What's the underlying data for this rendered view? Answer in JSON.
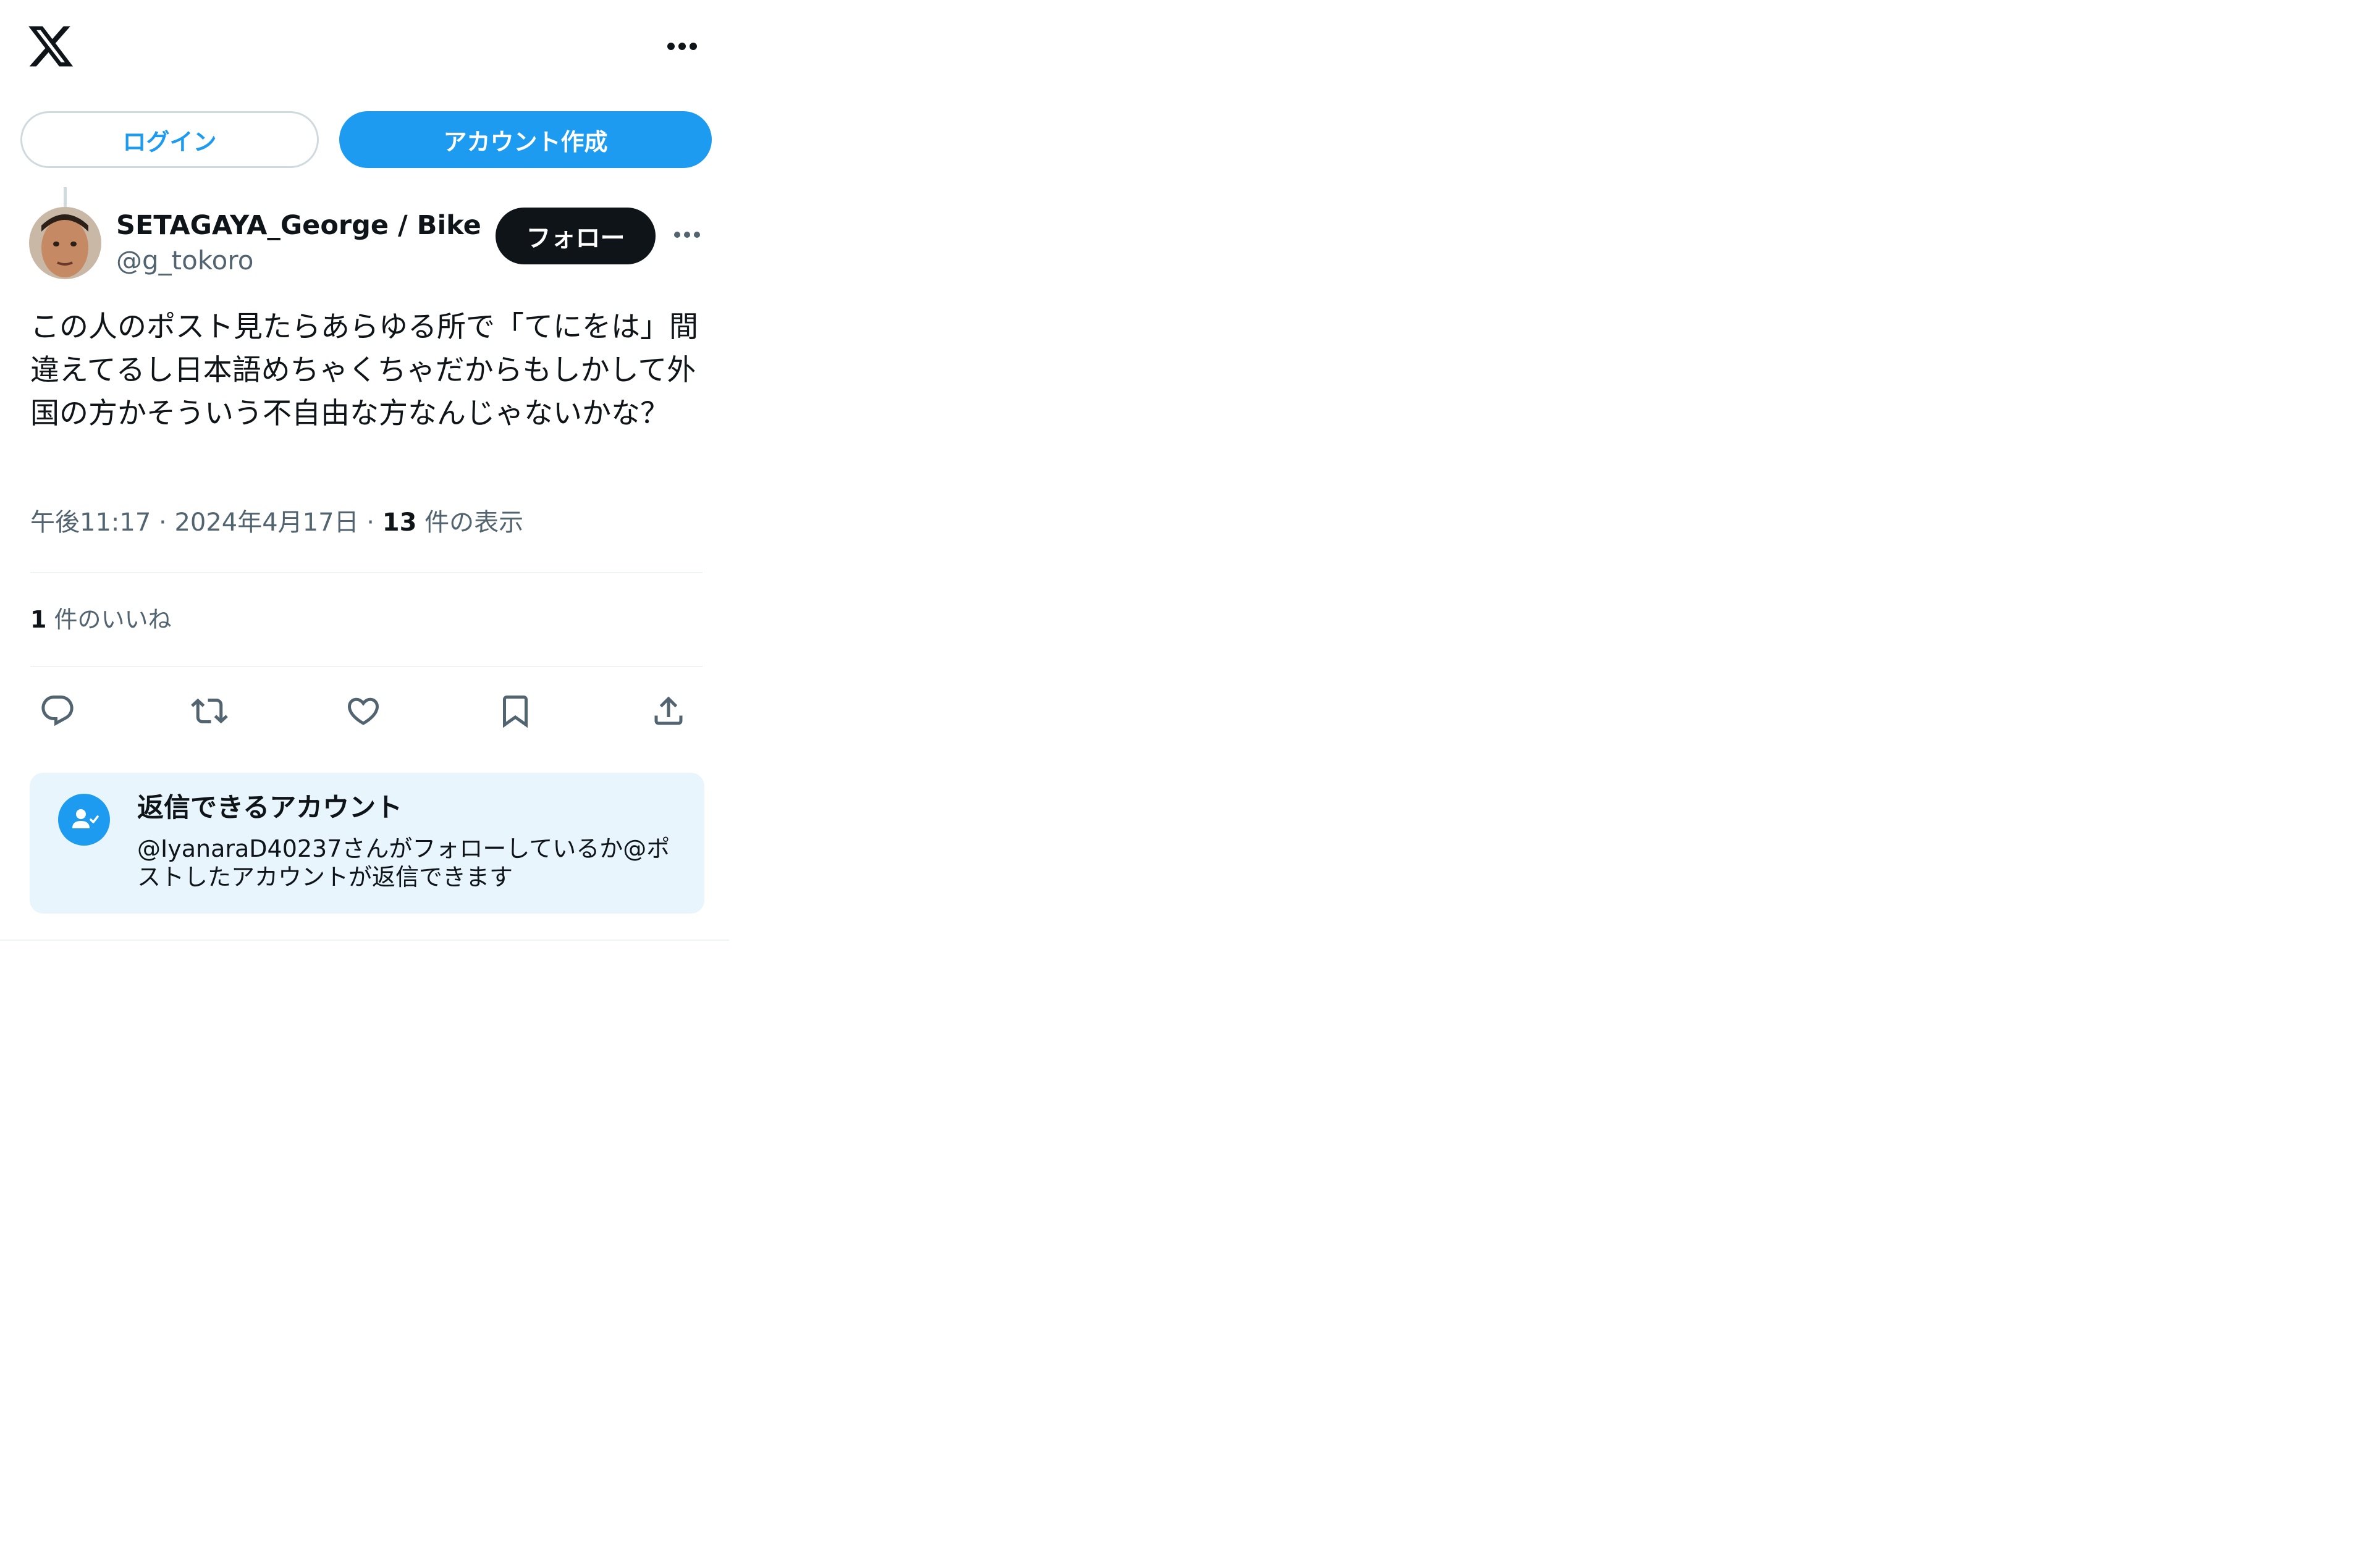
{
  "header": {
    "logo_icon": "x-logo-icon",
    "more_icon": "more-horizontal-icon",
    "login_label": "ログイン",
    "signup_label": "アカウント作成"
  },
  "post": {
    "author_name": "SETAGAYA_George / Bikers fa",
    "author_handle": "@g_tokoro",
    "follow_label": "フォロー",
    "more_icon": "more-horizontal-icon",
    "text": "この人のポスト見たらあらゆる所で「てにをは」間違えてるし日本語めちゃくちゃだからもしかして外国の方かそういう不自由な方なんじゃないかな？",
    "time": "午後11:17",
    "date": "2024年4月17日",
    "views_count": "13",
    "views_label": "件の表示",
    "likes_count": "1",
    "likes_label": "件のいいね"
  },
  "actions": [
    {
      "name": "reply",
      "icon": "reply-icon"
    },
    {
      "name": "repost",
      "icon": "repost-icon"
    },
    {
      "name": "like",
      "icon": "heart-icon"
    },
    {
      "name": "bookmark",
      "icon": "bookmark-icon"
    },
    {
      "name": "share",
      "icon": "share-icon"
    }
  ],
  "reply_restriction": {
    "icon": "person-check-icon",
    "title": "返信できるアカウント",
    "description": "@IyanaraD40237さんがフォローしているか@ポストしたアカウントが返信できます"
  },
  "colors": {
    "accent": "#1d9bf0",
    "text": "#0f1419",
    "secondary": "#536471",
    "card_bg": "#e8f5fd"
  }
}
